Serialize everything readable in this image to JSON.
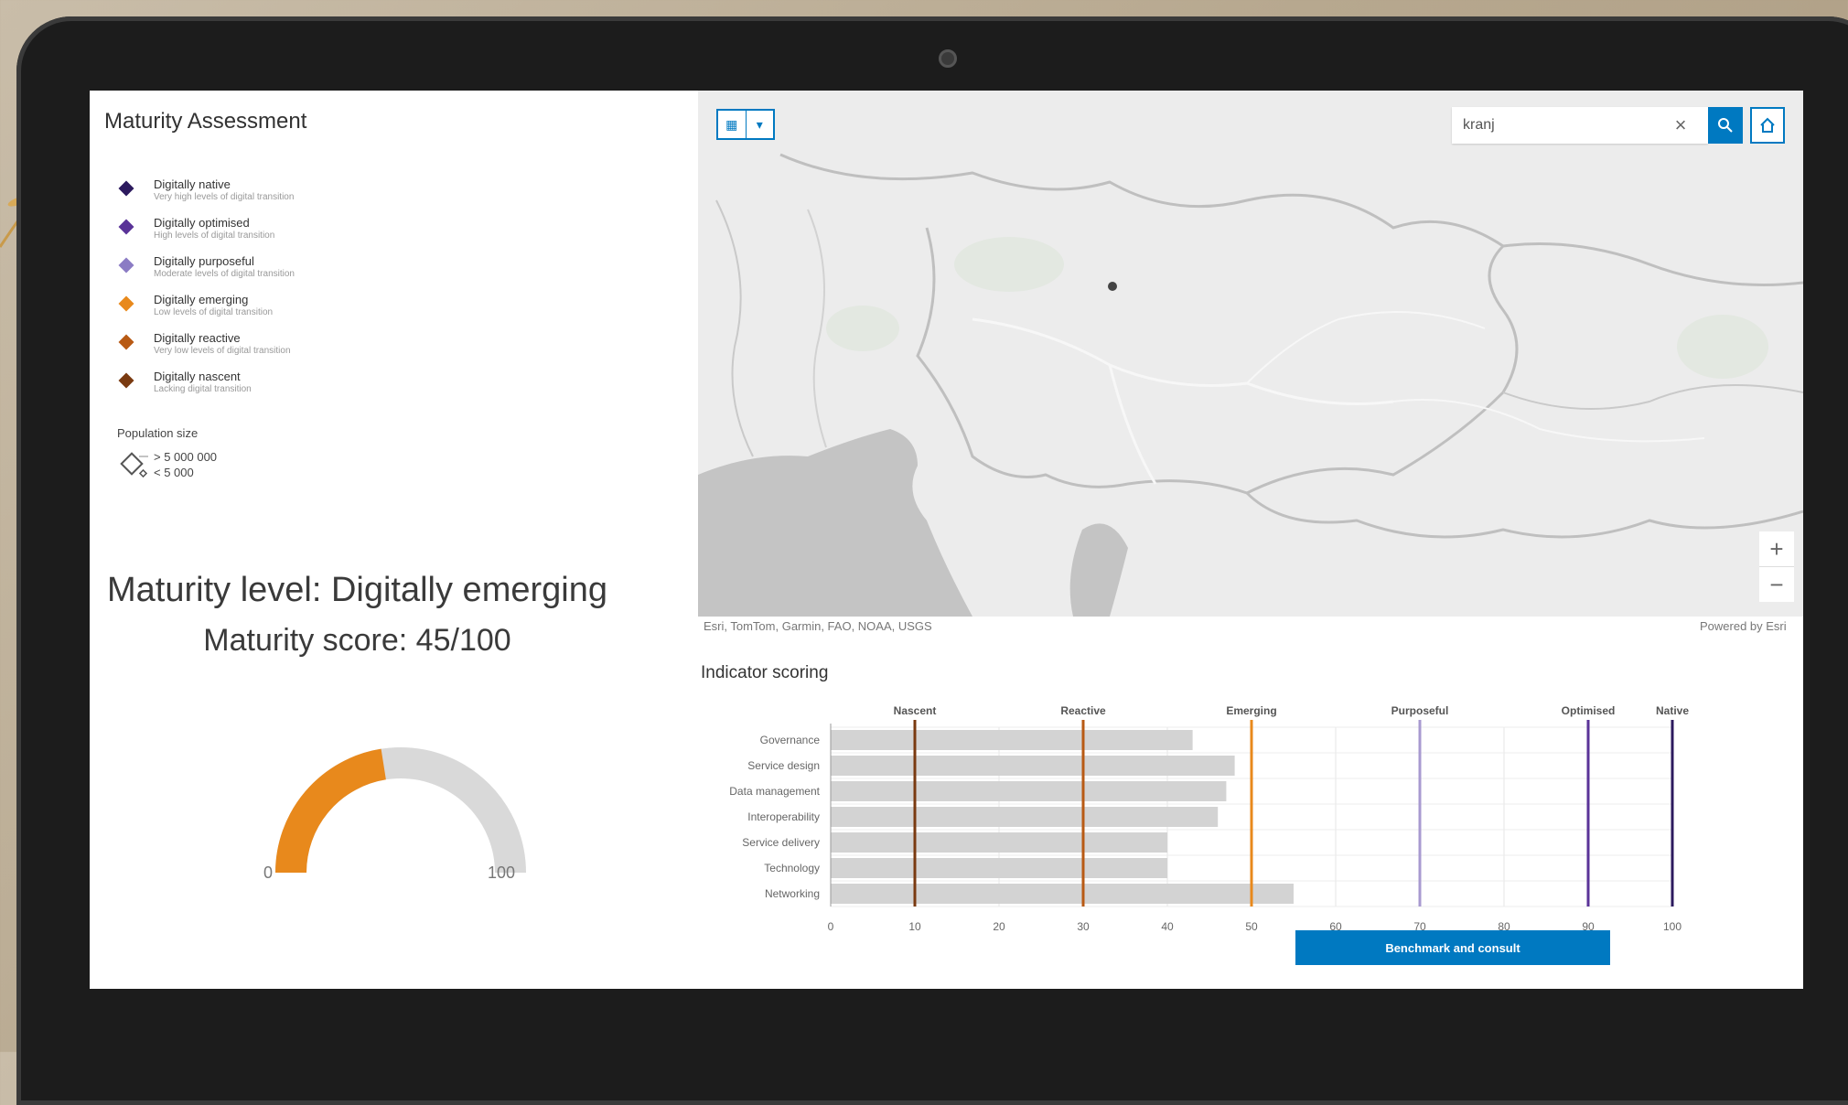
{
  "panel": {
    "title": "Maturity Assessment"
  },
  "legend": {
    "items": [
      {
        "label": "Digitally native",
        "sub": "Very high levels of digital transition",
        "color": "#2c1a5e"
      },
      {
        "label": "Digitally optimised",
        "sub": "High levels of digital transition",
        "color": "#5a3398"
      },
      {
        "label": "Digitally purposeful",
        "sub": "Moderate levels of digital transition",
        "color": "#8b7cc4"
      },
      {
        "label": "Digitally emerging",
        "sub": "Low levels of digital transition",
        "color": "#e8891c"
      },
      {
        "label": "Digitally reactive",
        "sub": "Very low levels of digital transition",
        "color": "#b85a14"
      },
      {
        "label": "Digitally nascent",
        "sub": "Lacking digital transition",
        "color": "#7a3a10"
      }
    ],
    "population_title": "Population size",
    "population_big": "> 5 000 000",
    "population_small": "< 5 000"
  },
  "maturity": {
    "level_text": "Maturity level: Digitally emerging",
    "score_text": "Maturity score: 45/100",
    "score": 45,
    "gauge_min": "0",
    "gauge_max": "100",
    "gauge_color": "#e8891c",
    "gauge_track_color": "#d9d9d9"
  },
  "map": {
    "search_value": "kranj",
    "attribution": "Esri, TomTom, Garmin, FAO, NOAA, USGS",
    "powered_by": "Powered by Esri"
  },
  "chart": {
    "title": "Indicator scoring",
    "button_label": "Benchmark and consult"
  },
  "chart_data": {
    "type": "bar",
    "orientation": "horizontal",
    "categories": [
      "Governance",
      "Service design",
      "Data management",
      "Interoperability",
      "Service delivery",
      "Technology",
      "Networking"
    ],
    "values": [
      43,
      48,
      47,
      46,
      40,
      40,
      55
    ],
    "xlim": [
      0,
      100
    ],
    "xticks": [
      "0",
      "10",
      "20",
      "30",
      "40",
      "50",
      "60",
      "70",
      "80",
      "90",
      "100"
    ],
    "bar_color": "#d3d3d3",
    "reference_lines": [
      {
        "label": "Nascent",
        "value": 10,
        "color": "#7a3a10"
      },
      {
        "label": "Reactive",
        "value": 30,
        "color": "#b85a14"
      },
      {
        "label": "Emerging",
        "value": 50,
        "color": "#e8891c"
      },
      {
        "label": "Purposeful",
        "value": 70,
        "color": "#a89ad0"
      },
      {
        "label": "Optimised",
        "value": 90,
        "color": "#5a3398"
      },
      {
        "label": "Native",
        "value": 100,
        "color": "#2c1a5e"
      }
    ]
  }
}
